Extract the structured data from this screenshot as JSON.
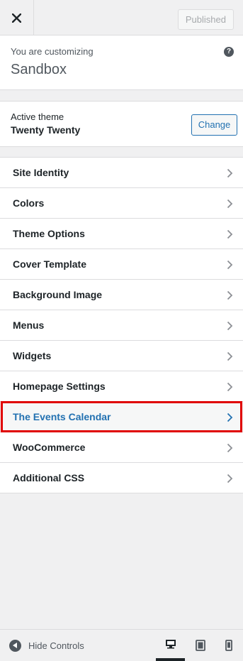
{
  "header": {
    "close_icon": "close-icon",
    "published_label": "Published"
  },
  "info": {
    "customizing_label": "You are customizing",
    "site_title": "Sandbox",
    "help_icon": "help-icon",
    "help_glyph": "?"
  },
  "theme": {
    "label": "Active theme",
    "name": "Twenty Twenty",
    "change_label": "Change"
  },
  "sections": [
    {
      "label": "Site Identity"
    },
    {
      "label": "Colors"
    },
    {
      "label": "Theme Options"
    },
    {
      "label": "Cover Template"
    },
    {
      "label": "Background Image"
    },
    {
      "label": "Menus"
    },
    {
      "label": "Widgets"
    },
    {
      "label": "Homepage Settings"
    },
    {
      "label": "The Events Calendar",
      "highlighted": true
    },
    {
      "label": "WooCommerce"
    },
    {
      "label": "Additional CSS"
    }
  ],
  "footer": {
    "hide_controls_label": "Hide Controls",
    "devices": [
      "desktop-icon",
      "tablet-icon",
      "mobile-icon"
    ],
    "active_device": "desktop"
  },
  "colors": {
    "accent": "#2271b1",
    "highlight_border": "#e00000"
  }
}
